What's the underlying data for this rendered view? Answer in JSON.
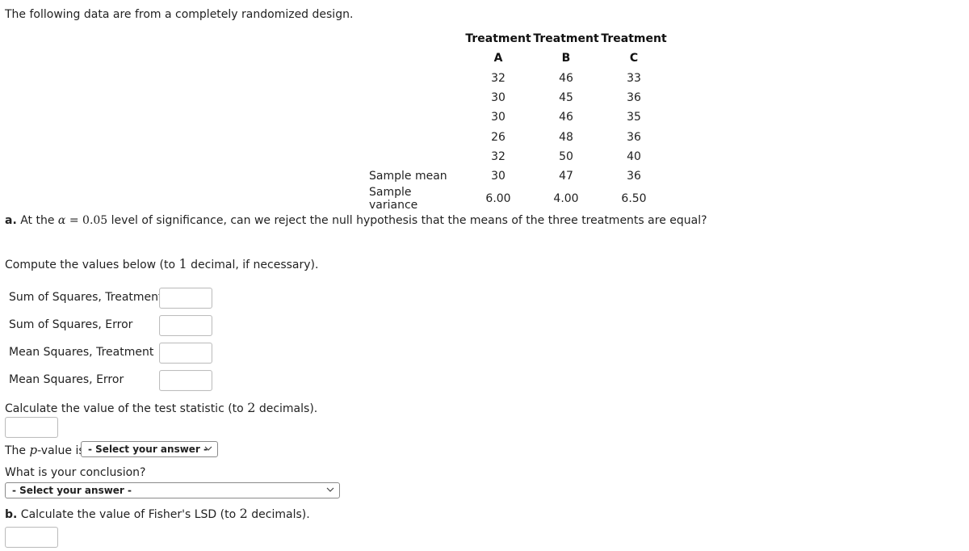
{
  "intro": "The following data are from a completely randomized design.",
  "table": {
    "headers": [
      {
        "line1": "Treatment",
        "line2": "A"
      },
      {
        "line1": "Treatment",
        "line2": "B"
      },
      {
        "line1": "Treatment",
        "line2": "C"
      }
    ],
    "rows": [
      {
        "label": "",
        "values": [
          "32",
          "46",
          "33"
        ]
      },
      {
        "label": "",
        "values": [
          "30",
          "45",
          "36"
        ]
      },
      {
        "label": "",
        "values": [
          "30",
          "46",
          "35"
        ]
      },
      {
        "label": "",
        "values": [
          "26",
          "48",
          "36"
        ]
      },
      {
        "label": "",
        "values": [
          "32",
          "50",
          "40"
        ]
      },
      {
        "label": "Sample mean",
        "values": [
          "30",
          "47",
          "36"
        ]
      },
      {
        "label": "Sample variance",
        "values": [
          "6.00",
          "4.00",
          "6.50"
        ]
      }
    ]
  },
  "part_a": {
    "prefix": "a.",
    "text1": " At the ",
    "alpha": "α",
    "equals": " = ",
    "alpha_value": "0.05",
    "text2": " level of significance, can we reject the null hypothesis that the means of the three treatments are equal?"
  },
  "compute": {
    "text1": "Compute the values below (to ",
    "num": "1",
    "text2": " decimal, if necessary)."
  },
  "fields": [
    {
      "label": "Sum of Squares, Treatment",
      "value": ""
    },
    {
      "label": "Sum of Squares, Error",
      "value": ""
    },
    {
      "label": "Mean Squares, Treatment",
      "value": ""
    },
    {
      "label": "Mean Squares, Error",
      "value": ""
    }
  ],
  "test_stat": {
    "text1": "Calculate the value of the test statistic (to ",
    "num": "2",
    "text2": " decimals).",
    "value": ""
  },
  "pvalue": {
    "text1": "The ",
    "p": "p",
    "text2": "-value is",
    "select": "- Select your answer -"
  },
  "conclusion": {
    "question": "What is your conclusion?",
    "select": "- Select your answer -"
  },
  "part_b": {
    "prefix": "b.",
    "text1": " Calculate the value of Fisher's LSD (to ",
    "num": "2",
    "text2": " decimals).",
    "value": ""
  }
}
